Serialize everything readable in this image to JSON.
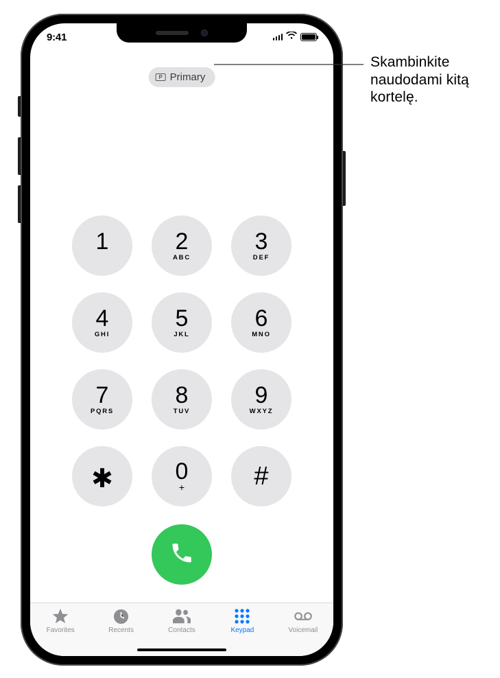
{
  "statusbar": {
    "time": "9:41"
  },
  "sim": {
    "badge_letter": "P",
    "label": "Primary"
  },
  "keys": [
    {
      "digit": "1",
      "letters": ""
    },
    {
      "digit": "2",
      "letters": "ABC"
    },
    {
      "digit": "3",
      "letters": "DEF"
    },
    {
      "digit": "4",
      "letters": "GHI"
    },
    {
      "digit": "5",
      "letters": "JKL"
    },
    {
      "digit": "6",
      "letters": "MNO"
    },
    {
      "digit": "7",
      "letters": "PQRS"
    },
    {
      "digit": "8",
      "letters": "TUV"
    },
    {
      "digit": "9",
      "letters": "WXYZ"
    },
    {
      "digit": "✱",
      "letters": ""
    },
    {
      "digit": "0",
      "letters": "+"
    },
    {
      "digit": "#",
      "letters": ""
    }
  ],
  "tabbar": {
    "favorites": "Favorites",
    "recents": "Recents",
    "contacts": "Contacts",
    "keypad": "Keypad",
    "voicemail": "Voicemail",
    "active_index": 3
  },
  "callout": "Skambinkite naudodami kitą kortelę."
}
